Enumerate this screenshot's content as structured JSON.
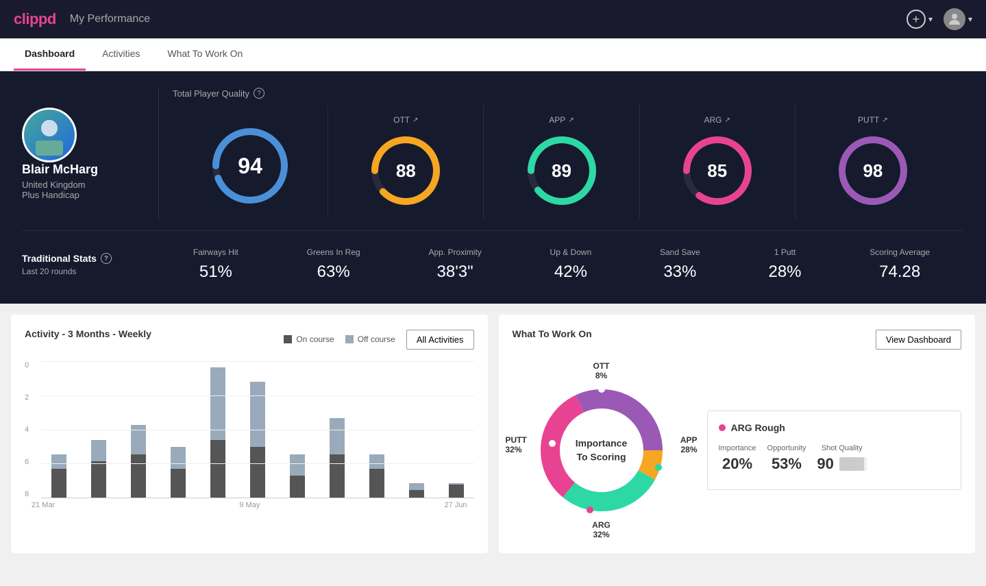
{
  "header": {
    "logo": "clippd",
    "title": "My Performance",
    "add_btn_label": "+",
    "avatar_label": "User"
  },
  "nav": {
    "tabs": [
      {
        "label": "Dashboard",
        "active": true
      },
      {
        "label": "Activities",
        "active": false
      },
      {
        "label": "What To Work On",
        "active": false
      }
    ]
  },
  "player": {
    "name": "Blair McHarg",
    "country": "United Kingdom",
    "handicap": "Plus Handicap",
    "quality_label": "Total Player Quality",
    "scores": [
      {
        "label": "Total",
        "value": 94,
        "color": "#4a90d9",
        "pct": 94
      },
      {
        "label": "OTT",
        "value": 88,
        "color": "#f5a623",
        "pct": 88
      },
      {
        "label": "APP",
        "value": 89,
        "color": "#2ed8a4",
        "pct": 89
      },
      {
        "label": "ARG",
        "value": 85,
        "color": "#e84393",
        "pct": 85
      },
      {
        "label": "PUTT",
        "value": 98,
        "color": "#9b59b6",
        "pct": 98
      }
    ]
  },
  "trad_stats": {
    "title": "Traditional Stats",
    "subtitle": "Last 20 rounds",
    "items": [
      {
        "label": "Fairways Hit",
        "value": "51%"
      },
      {
        "label": "Greens In Reg",
        "value": "63%"
      },
      {
        "label": "App. Proximity",
        "value": "38'3\""
      },
      {
        "label": "Up & Down",
        "value": "42%"
      },
      {
        "label": "Sand Save",
        "value": "33%"
      },
      {
        "label": "1 Putt",
        "value": "28%"
      },
      {
        "label": "Scoring Average",
        "value": "74.28"
      }
    ]
  },
  "activity_chart": {
    "title": "Activity - 3 Months - Weekly",
    "legend": {
      "on_course": "On course",
      "off_course": "Off course"
    },
    "all_btn": "All Activities",
    "y_labels": [
      "0",
      "2",
      "4",
      "6",
      "8"
    ],
    "x_labels": [
      "21 Mar",
      "9 May",
      "27 Jun"
    ],
    "bars": [
      {
        "on": 20,
        "off": 10
      },
      {
        "on": 25,
        "off": 15
      },
      {
        "on": 30,
        "off": 20
      },
      {
        "on": 20,
        "off": 15
      },
      {
        "on": 40,
        "off": 50
      },
      {
        "on": 35,
        "off": 45
      },
      {
        "on": 15,
        "off": 15
      },
      {
        "on": 30,
        "off": 25
      },
      {
        "on": 20,
        "off": 10
      },
      {
        "on": 5,
        "off": 5
      },
      {
        "on": 10,
        "off": 0
      }
    ]
  },
  "work_on": {
    "title": "What To Work On",
    "view_btn": "View Dashboard",
    "center_text": "Importance\nTo Scoring",
    "segments": [
      {
        "label": "OTT",
        "pct": "8%",
        "color": "#f5a623"
      },
      {
        "label": "APP",
        "pct": "28%",
        "color": "#2ed8a4"
      },
      {
        "label": "ARG",
        "pct": "32%",
        "color": "#e84393"
      },
      {
        "label": "PUTT",
        "pct": "32%",
        "color": "#9b59b6"
      }
    ],
    "detail": {
      "title": "ARG Rough",
      "dot_color": "#e84393",
      "importance_label": "Importance",
      "importance_value": "20%",
      "opportunity_label": "Opportunity",
      "opportunity_value": "53%",
      "quality_label": "Shot Quality",
      "quality_value": "90"
    }
  }
}
